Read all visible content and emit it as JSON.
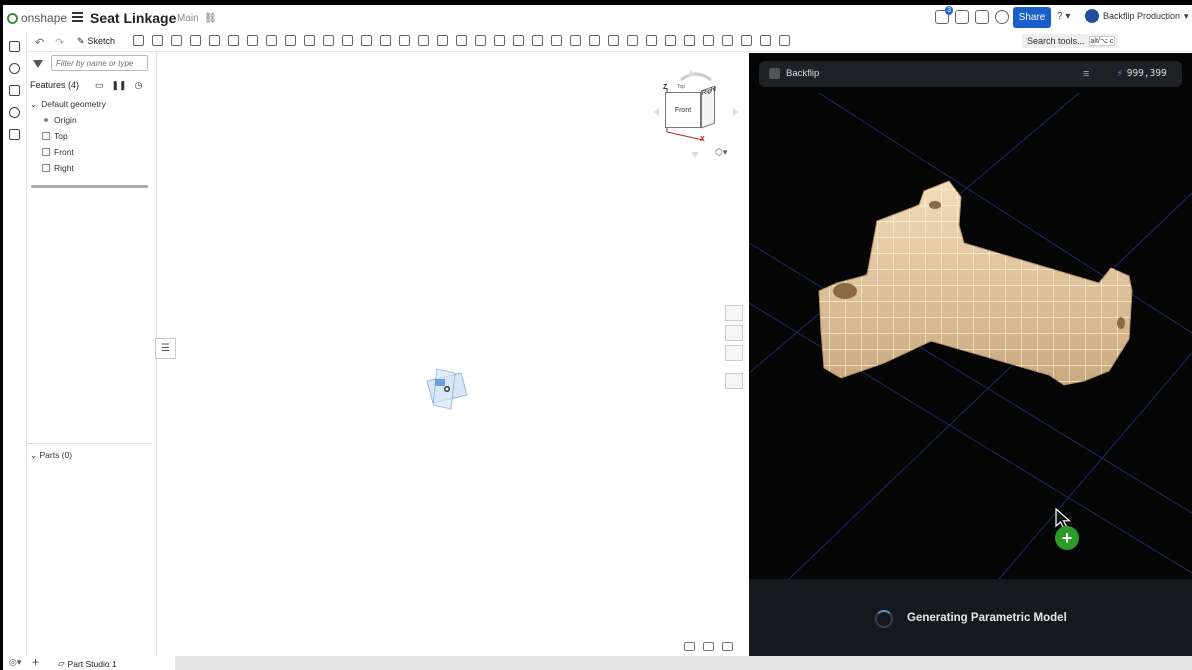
{
  "header": {
    "brand": "onshape",
    "document_title": "Seat Linkage",
    "branch": "Main",
    "notification_count": "3",
    "share_label": "Share",
    "help_label": "?",
    "user_name": "Backflip Production"
  },
  "toolbar": {
    "sketch_label": "Sketch",
    "search_label": "Search tools...",
    "search_shortcut": "alt/⌥ c"
  },
  "features": {
    "filter_placeholder": "Filter by name or type",
    "title": "Features (4)",
    "default_geometry": "Default geometry",
    "items": [
      "Origin",
      "Top",
      "Front",
      "Right"
    ],
    "parts": "Parts (0)"
  },
  "viewcube": {
    "front": "Front",
    "right": "Right",
    "top": "Top",
    "z_axis": "Z",
    "x_axis": "X"
  },
  "bottom_bar": {
    "add": "+",
    "tab_part_studio": "Part Studio 1"
  },
  "backflip": {
    "title": "Backflip",
    "credits": "999,399",
    "status": "Generating Parametric Model"
  },
  "colors": {
    "accent": "#1a5fc9",
    "panel_bg": "#050505",
    "spinner": "#5a8ee0",
    "plus": "#2c9b2c",
    "model": "#e9cfa8"
  }
}
